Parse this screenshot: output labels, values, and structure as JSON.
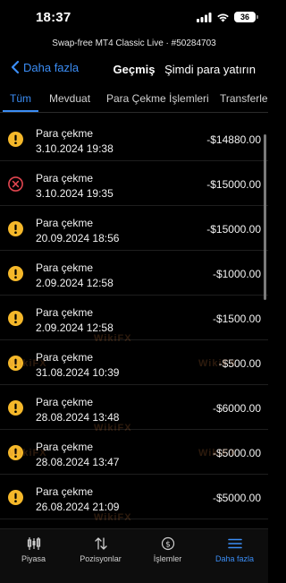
{
  "status_bar": {
    "time": "18:37",
    "battery": "36"
  },
  "account_line": "Swap-free MT4 Classic Live · #50284703",
  "nav": {
    "back_label": "Daha fazla",
    "title": "Geçmiş",
    "deposit_label": "Şimdi para yatırın"
  },
  "tabs": [
    {
      "label": "Tüm",
      "active": true
    },
    {
      "label": "Mevduat",
      "active": false
    },
    {
      "label": "Para Çekme İşlemleri",
      "active": false
    },
    {
      "label": "Transferle",
      "active": false
    }
  ],
  "transactions": [
    {
      "title": "Para çekme",
      "date": "3.10.2024 19:38",
      "amount": "-$14880.00",
      "status_icon": "warning-icon"
    },
    {
      "title": "Para çekme",
      "date": "3.10.2024 19:35",
      "amount": "-$15000.00",
      "status_icon": "cancel-icon"
    },
    {
      "title": "Para çekme",
      "date": "20.09.2024 18:56",
      "amount": "-$15000.00",
      "status_icon": "warning-icon"
    },
    {
      "title": "Para çekme",
      "date": "2.09.2024 12:58",
      "amount": "-$1000.00",
      "status_icon": "warning-icon"
    },
    {
      "title": "Para çekme",
      "date": "2.09.2024 12:58",
      "amount": "-$1500.00",
      "status_icon": "warning-icon"
    },
    {
      "title": "Para çekme",
      "date": "31.08.2024 10:39",
      "amount": "-$500.00",
      "status_icon": "warning-icon"
    },
    {
      "title": "Para çekme",
      "date": "28.08.2024 13:48",
      "amount": "-$6000.00",
      "status_icon": "warning-icon"
    },
    {
      "title": "Para çekme",
      "date": "28.08.2024 13:47",
      "amount": "-$5000.00",
      "status_icon": "warning-icon"
    },
    {
      "title": "Para çekme",
      "date": "26.08.2024 21:09",
      "amount": "-$5000.00",
      "status_icon": "warning-icon"
    }
  ],
  "watermark": "WikiFX",
  "bottom_tabs": [
    {
      "label": "Piyasa",
      "icon": "candlestick-icon",
      "active": false
    },
    {
      "label": "Pozisyonlar",
      "icon": "updown-arrows-icon",
      "active": false
    },
    {
      "label": "İşlemler",
      "icon": "dollar-coin-icon",
      "active": false
    },
    {
      "label": "Daha fazla",
      "icon": "menu-icon",
      "active": true
    }
  ],
  "colors": {
    "accent": "#3b8df5",
    "warning": "#f5b82a",
    "cancel": "#e0454f",
    "background": "#000000"
  }
}
